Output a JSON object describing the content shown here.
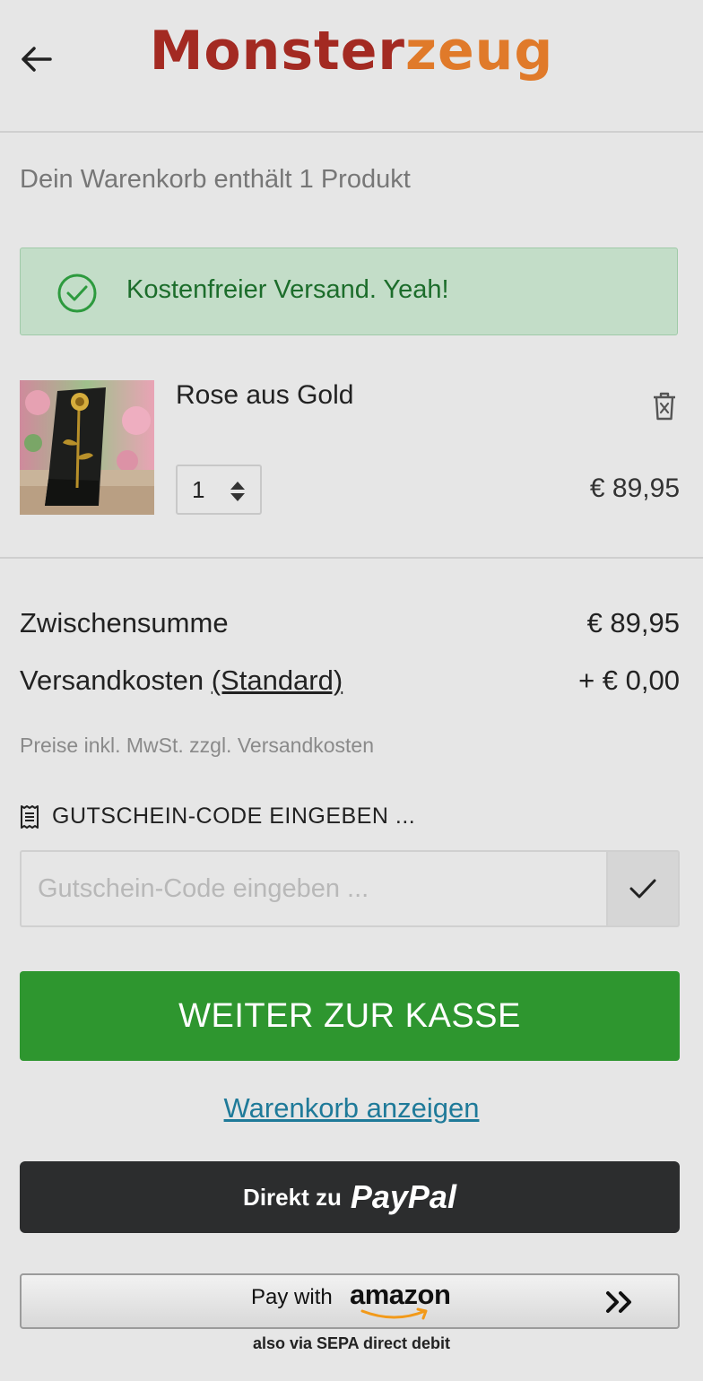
{
  "header": {
    "logo_part1": "Monster",
    "logo_part2": "zeug",
    "logo_colors": [
      "#a32a22",
      "#e07a2a"
    ],
    "back_icon": "arrow-left-icon"
  },
  "cart": {
    "count_text": "Dein Warenkorb enthält 1 Produkt",
    "shipping_notice": "Kostenfreier Versand. Yeah!",
    "notice_icon": "check-circle-icon",
    "items": [
      {
        "name": "Rose aus Gold",
        "quantity": "1",
        "price": "€ 89,95",
        "delete_icon": "trash-icon"
      }
    ]
  },
  "summary": {
    "subtotal_label": "Zwischensumme",
    "subtotal_value": "€ 89,95",
    "shipping_label": "Versandkosten",
    "shipping_method": "(Standard)",
    "shipping_value": "+ € 0,00",
    "tax_note": "Preise inkl. MwSt. zzgl. Versandkosten"
  },
  "coupon": {
    "label": "GUTSCHEIN-CODE EINGEBEN ...",
    "placeholder": "Gutschein-Code eingeben ...",
    "icon": "receipt-icon",
    "submit_icon": "checkmark-icon"
  },
  "actions": {
    "checkout_label": "WEITER ZUR KASSE",
    "checkout_color": "#2e962f",
    "view_cart_label": "Warenkorb anzeigen",
    "paypal_prefix": "Direkt zu",
    "paypal_brand": "PayPal",
    "amazon_prefix": "Pay with",
    "amazon_brand": "amazon",
    "amazon_subtitle": "also via SEPA direct debit"
  }
}
